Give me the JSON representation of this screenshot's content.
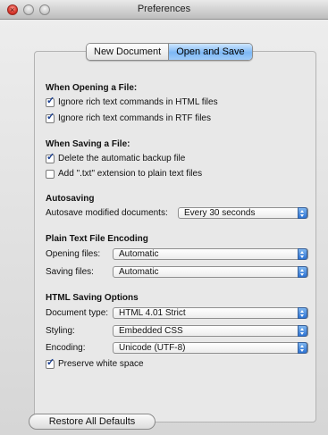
{
  "window": {
    "title": "Preferences"
  },
  "tabs": [
    {
      "label": "New Document",
      "active": false
    },
    {
      "label": "Open and Save",
      "active": true
    }
  ],
  "opening": {
    "heading": "When Opening a File:",
    "ignore_html": {
      "label": "Ignore rich text commands in HTML files",
      "checked": true
    },
    "ignore_rtf": {
      "label": "Ignore rich text commands in RTF files",
      "checked": true
    }
  },
  "saving": {
    "heading": "When Saving a File:",
    "delete_backup": {
      "label": "Delete the automatic backup file",
      "checked": true
    },
    "add_txt": {
      "label": "Add \".txt\" extension to plain text files",
      "checked": false
    }
  },
  "autosaving": {
    "heading": "Autosaving",
    "label": "Autosave modified documents:",
    "value": "Every 30 seconds"
  },
  "encoding": {
    "heading": "Plain Text File Encoding",
    "opening_label": "Opening files:",
    "opening_value": "Automatic",
    "saving_label": "Saving files:",
    "saving_value": "Automatic"
  },
  "html_options": {
    "heading": "HTML Saving Options",
    "doctype_label": "Document type:",
    "doctype_value": "HTML 4.01 Strict",
    "styling_label": "Styling:",
    "styling_value": "Embedded CSS",
    "encoding_label": "Encoding:",
    "encoding_value": "Unicode (UTF-8)",
    "preserve": {
      "label": "Preserve white space",
      "checked": true
    }
  },
  "restore_label": "Restore All Defaults",
  "colors": {
    "accent": "#7db8f5",
    "popup_arrow": "#2d73d3",
    "close_light": "#d8362c"
  }
}
